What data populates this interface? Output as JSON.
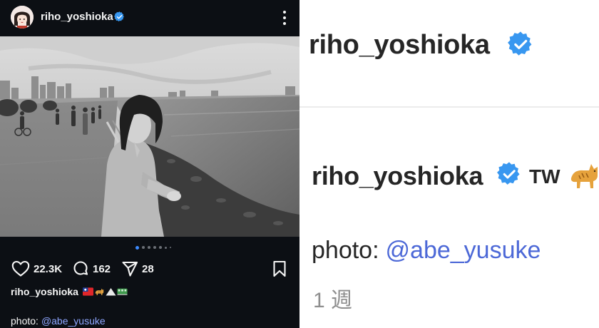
{
  "post": {
    "username": "riho_yoshioka",
    "avatar_icon": "avatar-illustration-icon",
    "verified_icon": "verified-badge-icon",
    "more_icon": "more-vertical-icon",
    "photo": {
      "style": "black-and-white",
      "carousel_count": 7,
      "carousel_active_index": 0
    },
    "actions": {
      "likes": "22.3K",
      "comments": "162",
      "shares": "28",
      "like_icon": "heart-icon",
      "comment_icon": "comment-bubble-icon",
      "share_icon": "send-icon",
      "save_icon": "bookmark-icon"
    },
    "caption": {
      "username": "riho_yoshioka",
      "emoji_icons": [
        "taiwan-flag-emoji-icon",
        "cat-emoji-icon",
        "mountain-emoji-icon",
        "train-emoji-icon"
      ]
    },
    "credit": {
      "prefix": "photo:",
      "mention": "@abe_yusuke"
    }
  },
  "zoom": {
    "title": "riho_yoshioka",
    "caption_username": "riho_yoshioka",
    "caption_flag_text": "TW",
    "caption_cat_icon": "cat-emoji-icon",
    "credit_prefix": "photo:",
    "credit_mention": "@abe_yusuke",
    "time_ago": "1 週"
  },
  "colors": {
    "dark_bg": "#0c0f14",
    "verified_blue": "#3897f0",
    "mention_dark": "#8ea6ff",
    "mention_light": "#4c68d7",
    "carousel_active": "#3d8bff"
  }
}
